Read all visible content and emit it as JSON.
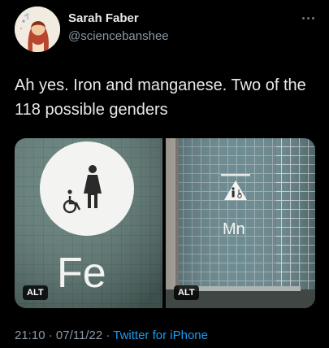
{
  "author": {
    "name": "Sarah Faber",
    "handle": "@sciencebanshee"
  },
  "tweet": {
    "text": "Ah yes. Iron and manganese. Two of the 118 possible genders"
  },
  "media": [
    {
      "sign_text": "Fe",
      "alt_badge": "ALT"
    },
    {
      "sign_text": "Mn",
      "alt_badge": "ALT"
    }
  ],
  "footer": {
    "time": "21:10",
    "date": "07/11/22",
    "separator": "·",
    "source": "Twitter for iPhone"
  },
  "colors": {
    "background": "#000000",
    "text_primary": "#e7e9ea",
    "text_secondary": "#8b98a5",
    "link": "#1d9bf0",
    "tile": "#4f6b67"
  },
  "icons": [
    "avatar-illustration",
    "more-options-icon",
    "woman-icon",
    "wheelchair-icon",
    "person-icon"
  ]
}
